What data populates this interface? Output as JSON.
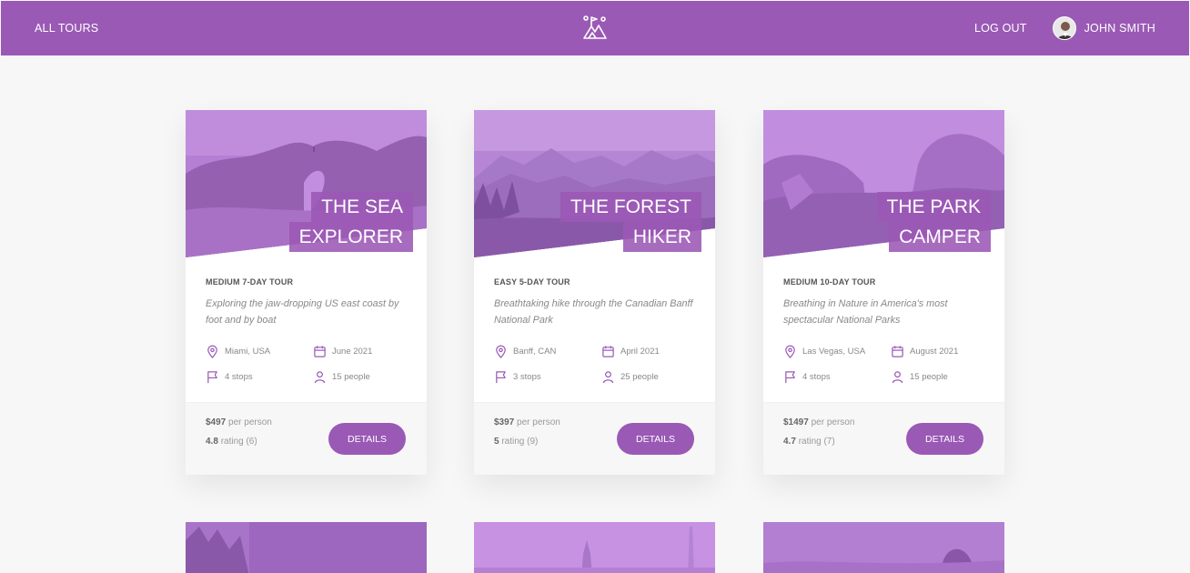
{
  "header": {
    "all_tours": "All tours",
    "logout": "Log out",
    "user_name": "John Smith"
  },
  "colors": {
    "brand": "#9a59b5",
    "background": "#f7f7f7"
  },
  "tours": [
    {
      "title_line1": "The Sea",
      "title_line2": "Explorer",
      "subtitle": "Medium 7-day tour",
      "summary": "Exploring the jaw-dropping US east coast by foot and by boat",
      "location": "Miami, USA",
      "date": "June 2021",
      "stops": "4 stops",
      "people": "15 people",
      "price": "$497",
      "price_unit": "per person",
      "rating": "4.8",
      "rating_label": "rating (6)",
      "button": "Details"
    },
    {
      "title_line1": "The Forest",
      "title_line2": "Hiker",
      "subtitle": "Easy 5-day tour",
      "summary": "Breathtaking hike through the Canadian Banff National Park",
      "location": "Banff, CAN",
      "date": "April 2021",
      "stops": "3 stops",
      "people": "25 people",
      "price": "$397",
      "price_unit": "per person",
      "rating": "5",
      "rating_label": "rating (9)",
      "button": "Details"
    },
    {
      "title_line1": "The Park",
      "title_line2": "Camper",
      "subtitle": "Medium 10-day tour",
      "summary": "Breathing in Nature in America's most spectacular National Parks",
      "location": "Las Vegas, USA",
      "date": "August 2021",
      "stops": "4 stops",
      "people": "15 people",
      "price": "$1497",
      "price_unit": "per person",
      "rating": "4.7",
      "rating_label": "rating (7)",
      "button": "Details"
    }
  ],
  "icons": {
    "location": "map-pin-icon",
    "date": "calendar-icon",
    "stops": "flag-icon",
    "people": "user-icon"
  }
}
